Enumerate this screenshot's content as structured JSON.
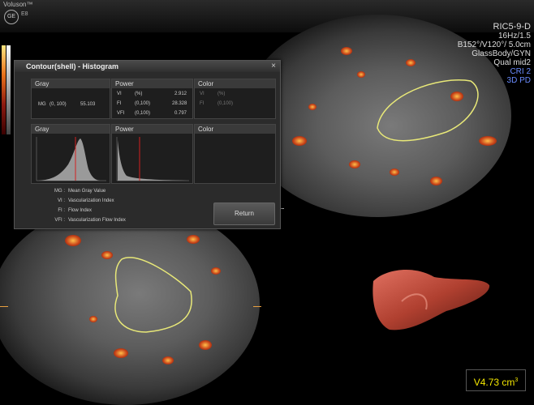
{
  "header": {
    "brand": "Voluson™",
    "model": "E8",
    "logo": "GE"
  },
  "scan_info": {
    "probe": "RIC5-9-D",
    "lines": [
      "16Hz/1.5",
      "B152°/V120°/ 5.0cm",
      "GlassBody/GYN",
      "Qual mid2"
    ],
    "cri": "CRI 2",
    "mode": "3D PD"
  },
  "dialog": {
    "title": "Contour(shell) - Histogram",
    "close": "×",
    "gray": {
      "label": "Gray",
      "row_label": "MG",
      "row_range": "(0, 100)",
      "row_value": "55.103"
    },
    "power": {
      "label": "Power",
      "rows": [
        {
          "k": "VI",
          "range": "(%)",
          "v": "2.912"
        },
        {
          "k": "FI",
          "range": "(0,100)",
          "v": "28.328"
        },
        {
          "k": "VFI",
          "range": "(0,100)",
          "v": "0.797"
        }
      ]
    },
    "color": {
      "label": "Color",
      "rows": [
        {
          "k": "VI",
          "range": "(%)"
        },
        {
          "k": "FI",
          "range": "(0,100)"
        }
      ]
    },
    "hist_labels": {
      "gray": "Gray",
      "power": "Power",
      "color": "Color"
    },
    "legend": [
      {
        "k": "MG :",
        "t": "Mean Gray Value"
      },
      {
        "k": "VI :",
        "t": "Vascularization Index"
      },
      {
        "k": "FI :",
        "t": "Flow Index"
      },
      {
        "k": "VFI :",
        "t": "Vascularization Flow Index"
      }
    ],
    "return": "Return"
  },
  "volume": {
    "value": "V4.73 cm",
    "unit_exp": "3"
  },
  "colors": {
    "volume_text": "#f5e800",
    "contour": "#e8e878",
    "doppler": "#d0501c"
  }
}
